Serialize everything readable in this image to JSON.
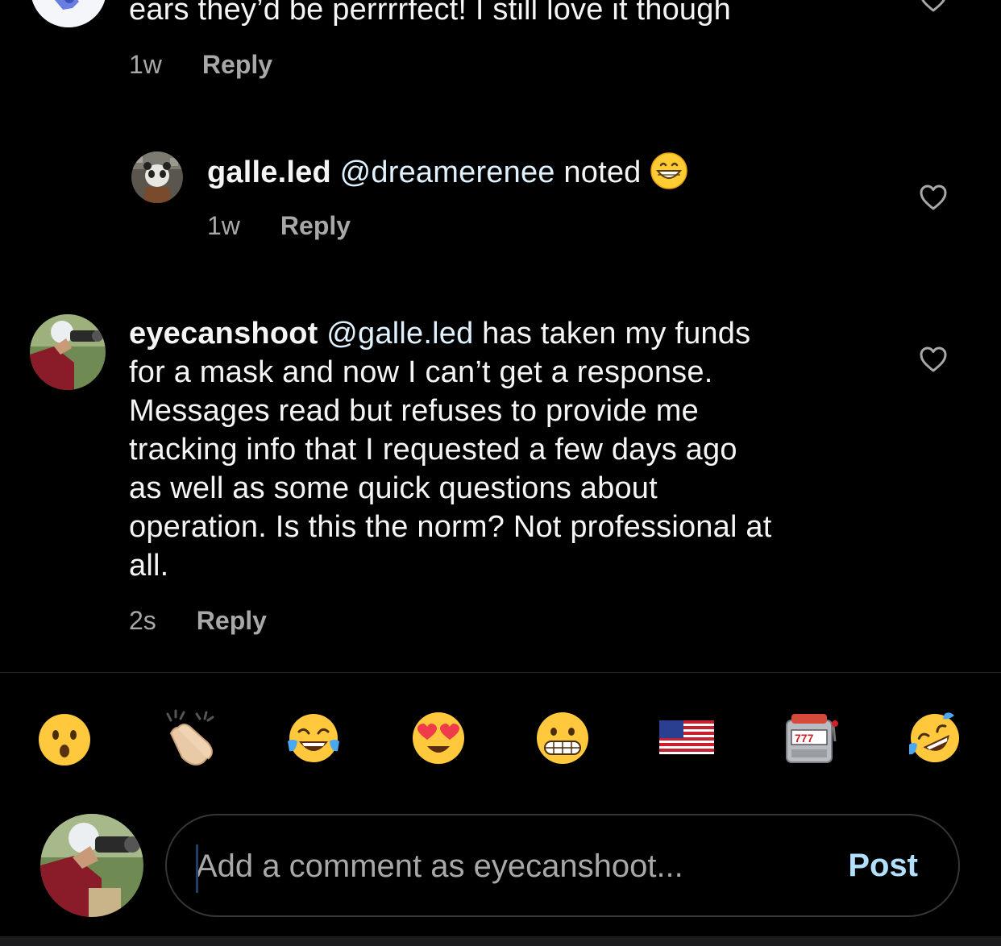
{
  "comments": [
    {
      "id": "prev",
      "text_tail": "ears they’d be perrrrfect! I still love it though",
      "time": "1w",
      "reply_label": "Reply"
    },
    {
      "id": "galle",
      "username": "galle.led",
      "mention": "@dreamerenee",
      "text": " noted ",
      "emoji": "grinning-face-icon",
      "time": "1w",
      "reply_label": "Reply"
    },
    {
      "id": "eyecan",
      "username": "eyecanshoot",
      "mention": "@galle.led",
      "line1_rest": " has taken my funds",
      "lines": [
        "for a mask and now I can’t get a response.",
        "Messages read but refuses to provide me",
        "tracking info that I requested a few days ago",
        "as well as some quick questions about",
        "operation. Is this the norm? Not professional at",
        "all."
      ],
      "time": "2s",
      "reply_label": "Reply"
    }
  ],
  "emoji_bar": [
    "hushed-face-icon",
    "clapping-hands-icon",
    "tears-of-joy-icon",
    "heart-eyes-icon",
    "grimacing-face-icon",
    "us-flag-icon",
    "slot-machine-icon",
    "rolling-laughing-icon"
  ],
  "composer": {
    "placeholder": "Add a comment as eyecanshoot...",
    "post_label": "Post"
  },
  "colors": {
    "background": "#000000",
    "text": "#f5f5f5",
    "muted": "#a8a8a8",
    "mention": "#e0f1ff",
    "post": "#b2dffc"
  }
}
